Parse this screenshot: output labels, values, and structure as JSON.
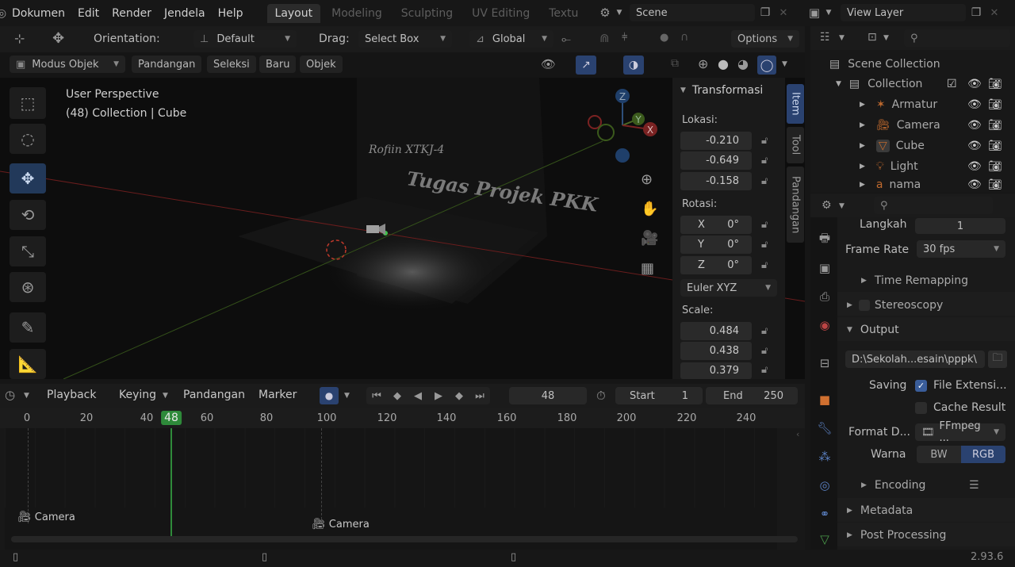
{
  "menu": [
    "Dokumen",
    "Edit",
    "Render",
    "Jendela",
    "Help"
  ],
  "workspaces": [
    {
      "label": "Layout",
      "active": true
    },
    {
      "label": "Modeling",
      "active": false
    },
    {
      "label": "Sculpting",
      "active": false
    },
    {
      "label": "UV Editing",
      "active": false
    },
    {
      "label": "Textu",
      "active": false
    }
  ],
  "scene_name": "Scene",
  "view_layer": "View Layer",
  "tool_header": {
    "orientation_label": "Orientation:",
    "orientation_value": "Default",
    "drag_label": "Drag:",
    "drag_value": "Select Box",
    "transform_orientation": "Global",
    "options": "Options"
  },
  "viewport_header": {
    "mode": "Modus Objek",
    "menus": [
      "Pandangan",
      "Seleksi",
      "Baru",
      "Objek"
    ]
  },
  "viewport": {
    "perspective": "User Perspective",
    "context": "(48) Collection | Cube",
    "scene_text_1": "Rofiin XTKJ-4",
    "scene_text_2": "Tugas Projek PKK",
    "gizmo": {
      "z": "Z",
      "y": "Y",
      "x": "X"
    }
  },
  "npanel": {
    "title": "Transformasi",
    "location_label": "Lokasi:",
    "location": [
      "-0.210",
      "-0.649",
      "-0.158"
    ],
    "rotation_label": "Rotasi:",
    "rotation": [
      {
        "axis": "X",
        "value": "0°"
      },
      {
        "axis": "Y",
        "value": "0°"
      },
      {
        "axis": "Z",
        "value": "0°"
      }
    ],
    "rotation_mode": "Euler XYZ",
    "scale_label": "Scale:",
    "scale": [
      "0.484",
      "0.438",
      "0.379"
    ],
    "tabs": [
      "Item",
      "Tool",
      "Pandangan"
    ]
  },
  "timeline": {
    "menus": [
      "Playback",
      "Keying",
      "Pandangan",
      "Marker"
    ],
    "current_frame": "48",
    "start_label": "Start",
    "start": "1",
    "end_label": "End",
    "end": "250",
    "ticks": [
      "0",
      "20",
      "40",
      "48",
      "60",
      "80",
      "100",
      "120",
      "140",
      "160",
      "180",
      "200",
      "220",
      "240"
    ],
    "marker_labels": [
      "Camera",
      "Camera"
    ]
  },
  "outliner": {
    "root": "Scene Collection",
    "collection": "Collection",
    "items": [
      {
        "name": "Armatur",
        "icon": "armature-icon"
      },
      {
        "name": "Camera",
        "icon": "camera-icon"
      },
      {
        "name": "Cube",
        "icon": "mesh-icon"
      },
      {
        "name": "Light",
        "icon": "light-icon"
      },
      {
        "name": "nama",
        "icon": "text-icon"
      }
    ]
  },
  "properties": {
    "langkah_label": "Langkah",
    "langkah_value": "1",
    "frame_rate_label": "Frame Rate",
    "frame_rate_value": "30 fps",
    "time_remapping": "Time Remapping",
    "stereoscopy": "Stereoscopy",
    "output": "Output",
    "output_path": "D:\\Sekolah...esain\\pppk\\",
    "saving_label": "Saving",
    "file_extension": "File Extensi...",
    "cache_result": "Cache Result",
    "format_label": "Format D...",
    "format_value": "FFmpeg ...",
    "warna_label": "Warna",
    "color_modes": [
      "BW",
      "RGB"
    ],
    "encoding": "Encoding",
    "metadata": "Metadata",
    "post_processing": "Post Processing"
  },
  "version": "2.93.6",
  "colors": {
    "accent": "#2a4270",
    "x_axis": "#7a2222",
    "y_axis": "#3b5a1c",
    "frame_line": "#2e8a3a"
  }
}
